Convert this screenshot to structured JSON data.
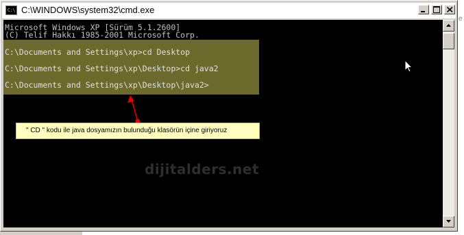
{
  "window": {
    "title": "C:\\WINDOWS\\system32\\cmd.exe",
    "icon": "cmd-icon",
    "icon_text": "C:\\"
  },
  "console": {
    "header_lines": [
      "Microsoft Windows XP [Sürüm 5.1.2600]",
      "(C) Telif Hakkı 1985-2001 Microsoft Corp."
    ],
    "commands": [
      "C:\\Documents and Settings\\xp>cd Desktop",
      "C:\\Documents and Settings\\xp\\Desktop>cd java2",
      "C:\\Documents and Settings\\xp\\Desktop\\java2>"
    ]
  },
  "annotation": {
    "text": "\" CD \" kodu ile java dosyamızın bulunduğu klasörün içine giriyoruz"
  },
  "watermark": "dijitalders.net",
  "side_fragment": "e",
  "colors": {
    "console_bg": "#000000",
    "console_text": "#c0c0c0",
    "highlight": "#6b6a2c",
    "tooltip_bg": "#ffffc0",
    "arrow": "#e00000"
  }
}
